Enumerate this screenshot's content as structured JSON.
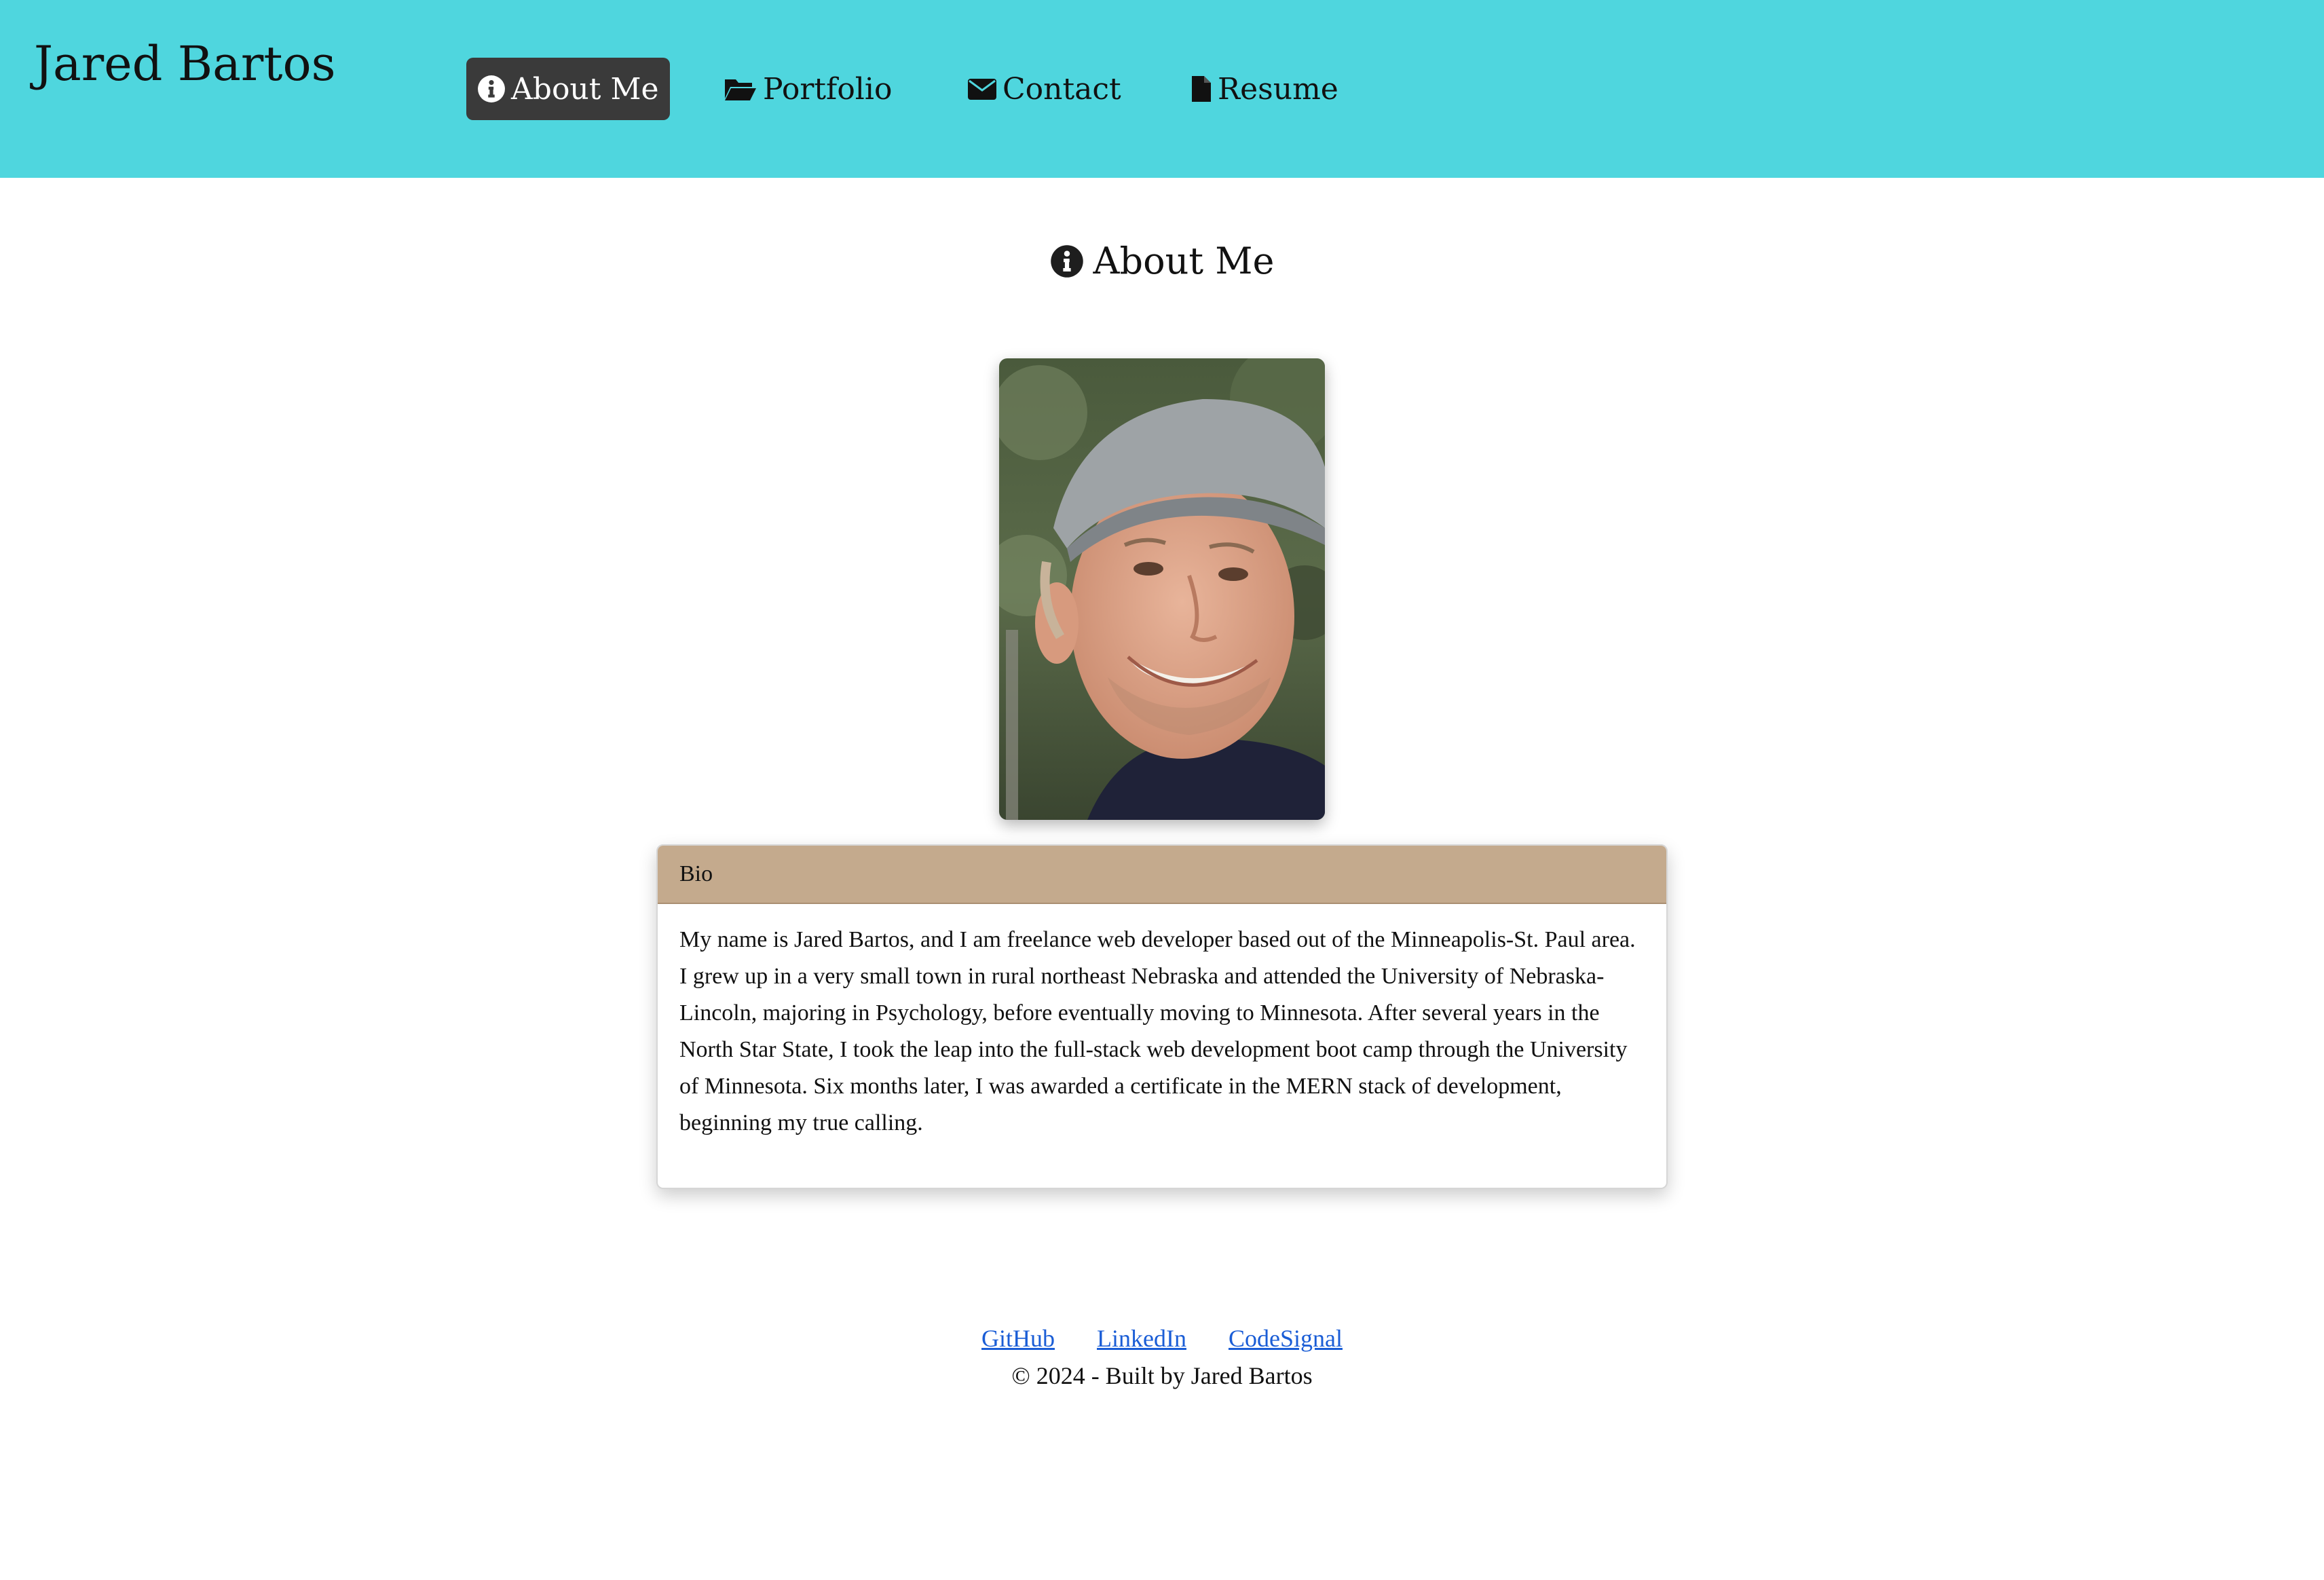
{
  "header": {
    "site_title": "Jared Bartos",
    "background_color": "#4fd6de",
    "nav": [
      {
        "label": "About Me",
        "icon": "info-circle-icon",
        "active": true
      },
      {
        "label": "Portfolio",
        "icon": "folder-open-icon",
        "active": false
      },
      {
        "label": "Contact",
        "icon": "envelope-icon",
        "active": false
      },
      {
        "label": "Resume",
        "icon": "file-icon",
        "active": false
      }
    ]
  },
  "main": {
    "heading": "About Me",
    "heading_icon": "info-circle-icon",
    "bio_card": {
      "header": "Bio",
      "header_color": "#c4aa8d",
      "body": "My name is Jared Bartos, and I am freelance web developer based out of the Minneapolis-St. Paul area. I grew up in a very small town in rural northeast Nebraska and attended the University of Nebraska-Lincoln, majoring in Psychology, before eventually moving to Minnesota. After several years in the North Star State, I took the leap into the full-stack web development boot camp through the University of Minnesota. Six months later, I was awarded a certificate in the MERN stack of development, beginning my true calling."
    }
  },
  "footer": {
    "links": [
      "GitHub",
      "LinkedIn",
      "CodeSignal"
    ],
    "link_color": "#1a5dd6",
    "copyright": "© 2024 - Built by Jared Bartos"
  }
}
